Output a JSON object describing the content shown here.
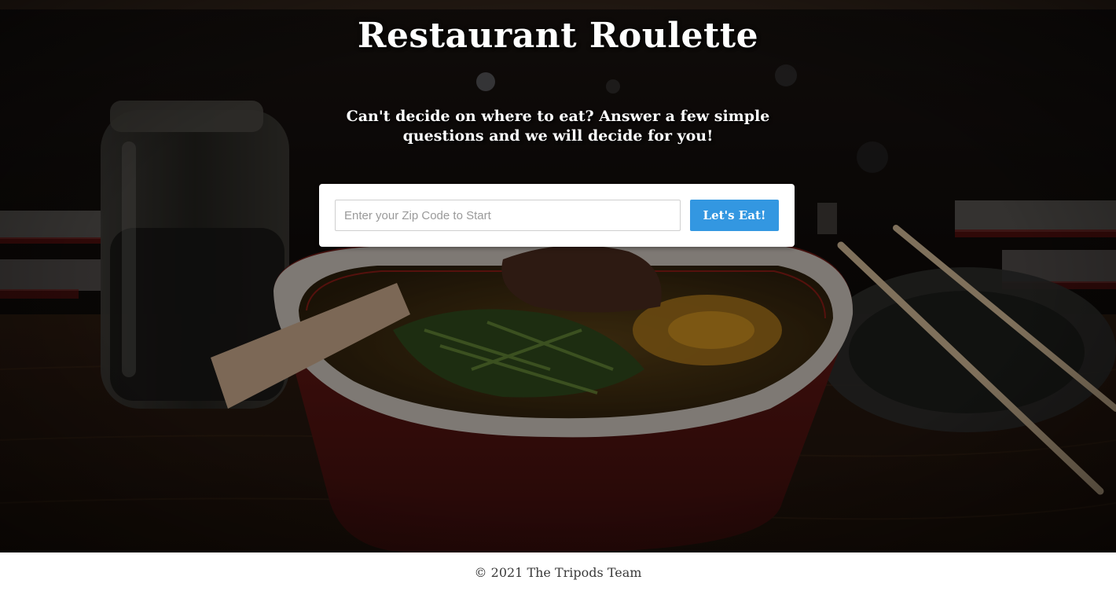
{
  "header": {
    "title": "Restaurant Roulette",
    "tagline": "Can't decide on where to eat? Answer a few simple questions and we will decide for you!"
  },
  "search": {
    "placeholder": "Enter your Zip Code to Start",
    "value": "",
    "button_label": "Let's Eat!"
  },
  "footer": {
    "text": "© 2021 The Tripods Team"
  },
  "colors": {
    "accent": "#3397e1",
    "hero_overlay": "#120d0a",
    "title_text": "#ffffff",
    "footer_text": "#3a3a3a"
  },
  "background_image": {
    "subject": "ramen bowl on wooden table"
  }
}
